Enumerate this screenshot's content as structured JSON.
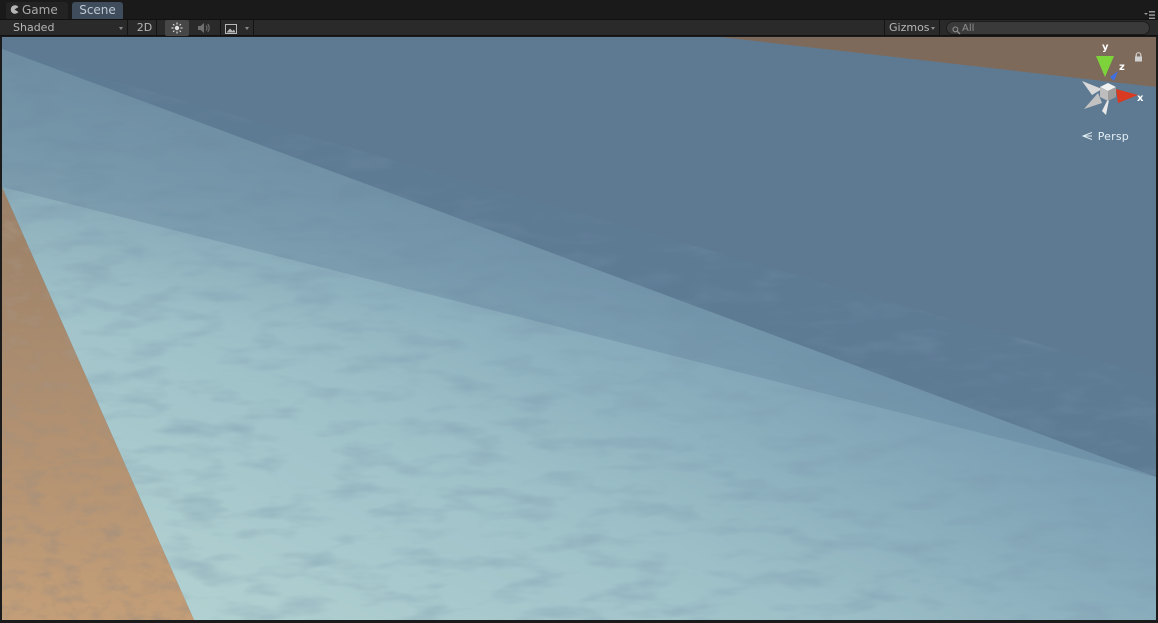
{
  "tabs": [
    {
      "label": "Game",
      "icon": "pacman-icon",
      "active": false
    },
    {
      "label": "Scene",
      "active": true
    }
  ],
  "toolbar": {
    "shading_mode": "Shaded",
    "mode_2d": "2D",
    "lighting_icon": "sun-icon",
    "audio_icon": "speaker-icon",
    "effects_icon": "image-icon",
    "gizmos": "Gizmos",
    "search_placeholder": "All",
    "search_icon": "search-icon"
  },
  "viewport": {
    "projection": "Persp",
    "axes": {
      "y": "y",
      "z": "z",
      "x": "x"
    },
    "colors": {
      "sky": "#5e7a92",
      "water_near": "#b4d2d3",
      "water_far": "#5a7e98",
      "sand": "#b38f6c",
      "far_shore": "#7e6a5b",
      "x_axis": "#d83a22",
      "y_axis": "#7cd43a",
      "z_axis": "#3f6fe0"
    }
  }
}
